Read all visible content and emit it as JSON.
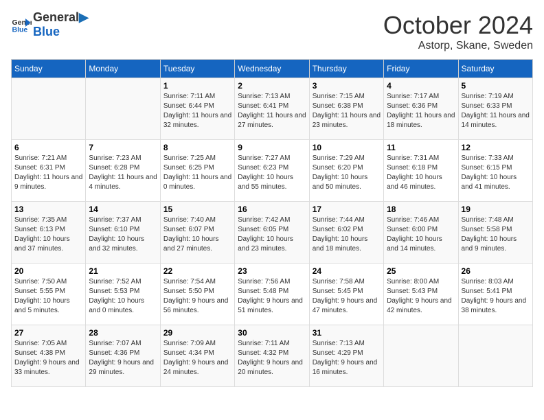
{
  "header": {
    "logo_line1": "General",
    "logo_line2": "Blue",
    "month": "October 2024",
    "location": "Astorp, Skane, Sweden"
  },
  "weekdays": [
    "Sunday",
    "Monday",
    "Tuesday",
    "Wednesday",
    "Thursday",
    "Friday",
    "Saturday"
  ],
  "weeks": [
    [
      {
        "day": "",
        "sunrise": "",
        "sunset": "",
        "daylight": ""
      },
      {
        "day": "",
        "sunrise": "",
        "sunset": "",
        "daylight": ""
      },
      {
        "day": "1",
        "sunrise": "Sunrise: 7:11 AM",
        "sunset": "Sunset: 6:44 PM",
        "daylight": "Daylight: 11 hours and 32 minutes."
      },
      {
        "day": "2",
        "sunrise": "Sunrise: 7:13 AM",
        "sunset": "Sunset: 6:41 PM",
        "daylight": "Daylight: 11 hours and 27 minutes."
      },
      {
        "day": "3",
        "sunrise": "Sunrise: 7:15 AM",
        "sunset": "Sunset: 6:38 PM",
        "daylight": "Daylight: 11 hours and 23 minutes."
      },
      {
        "day": "4",
        "sunrise": "Sunrise: 7:17 AM",
        "sunset": "Sunset: 6:36 PM",
        "daylight": "Daylight: 11 hours and 18 minutes."
      },
      {
        "day": "5",
        "sunrise": "Sunrise: 7:19 AM",
        "sunset": "Sunset: 6:33 PM",
        "daylight": "Daylight: 11 hours and 14 minutes."
      }
    ],
    [
      {
        "day": "6",
        "sunrise": "Sunrise: 7:21 AM",
        "sunset": "Sunset: 6:31 PM",
        "daylight": "Daylight: 11 hours and 9 minutes."
      },
      {
        "day": "7",
        "sunrise": "Sunrise: 7:23 AM",
        "sunset": "Sunset: 6:28 PM",
        "daylight": "Daylight: 11 hours and 4 minutes."
      },
      {
        "day": "8",
        "sunrise": "Sunrise: 7:25 AM",
        "sunset": "Sunset: 6:25 PM",
        "daylight": "Daylight: 11 hours and 0 minutes."
      },
      {
        "day": "9",
        "sunrise": "Sunrise: 7:27 AM",
        "sunset": "Sunset: 6:23 PM",
        "daylight": "Daylight: 10 hours and 55 minutes."
      },
      {
        "day": "10",
        "sunrise": "Sunrise: 7:29 AM",
        "sunset": "Sunset: 6:20 PM",
        "daylight": "Daylight: 10 hours and 50 minutes."
      },
      {
        "day": "11",
        "sunrise": "Sunrise: 7:31 AM",
        "sunset": "Sunset: 6:18 PM",
        "daylight": "Daylight: 10 hours and 46 minutes."
      },
      {
        "day": "12",
        "sunrise": "Sunrise: 7:33 AM",
        "sunset": "Sunset: 6:15 PM",
        "daylight": "Daylight: 10 hours and 41 minutes."
      }
    ],
    [
      {
        "day": "13",
        "sunrise": "Sunrise: 7:35 AM",
        "sunset": "Sunset: 6:13 PM",
        "daylight": "Daylight: 10 hours and 37 minutes."
      },
      {
        "day": "14",
        "sunrise": "Sunrise: 7:37 AM",
        "sunset": "Sunset: 6:10 PM",
        "daylight": "Daylight: 10 hours and 32 minutes."
      },
      {
        "day": "15",
        "sunrise": "Sunrise: 7:40 AM",
        "sunset": "Sunset: 6:07 PM",
        "daylight": "Daylight: 10 hours and 27 minutes."
      },
      {
        "day": "16",
        "sunrise": "Sunrise: 7:42 AM",
        "sunset": "Sunset: 6:05 PM",
        "daylight": "Daylight: 10 hours and 23 minutes."
      },
      {
        "day": "17",
        "sunrise": "Sunrise: 7:44 AM",
        "sunset": "Sunset: 6:02 PM",
        "daylight": "Daylight: 10 hours and 18 minutes."
      },
      {
        "day": "18",
        "sunrise": "Sunrise: 7:46 AM",
        "sunset": "Sunset: 6:00 PM",
        "daylight": "Daylight: 10 hours and 14 minutes."
      },
      {
        "day": "19",
        "sunrise": "Sunrise: 7:48 AM",
        "sunset": "Sunset: 5:58 PM",
        "daylight": "Daylight: 10 hours and 9 minutes."
      }
    ],
    [
      {
        "day": "20",
        "sunrise": "Sunrise: 7:50 AM",
        "sunset": "Sunset: 5:55 PM",
        "daylight": "Daylight: 10 hours and 5 minutes."
      },
      {
        "day": "21",
        "sunrise": "Sunrise: 7:52 AM",
        "sunset": "Sunset: 5:53 PM",
        "daylight": "Daylight: 10 hours and 0 minutes."
      },
      {
        "day": "22",
        "sunrise": "Sunrise: 7:54 AM",
        "sunset": "Sunset: 5:50 PM",
        "daylight": "Daylight: 9 hours and 56 minutes."
      },
      {
        "day": "23",
        "sunrise": "Sunrise: 7:56 AM",
        "sunset": "Sunset: 5:48 PM",
        "daylight": "Daylight: 9 hours and 51 minutes."
      },
      {
        "day": "24",
        "sunrise": "Sunrise: 7:58 AM",
        "sunset": "Sunset: 5:45 PM",
        "daylight": "Daylight: 9 hours and 47 minutes."
      },
      {
        "day": "25",
        "sunrise": "Sunrise: 8:00 AM",
        "sunset": "Sunset: 5:43 PM",
        "daylight": "Daylight: 9 hours and 42 minutes."
      },
      {
        "day": "26",
        "sunrise": "Sunrise: 8:03 AM",
        "sunset": "Sunset: 5:41 PM",
        "daylight": "Daylight: 9 hours and 38 minutes."
      }
    ],
    [
      {
        "day": "27",
        "sunrise": "Sunrise: 7:05 AM",
        "sunset": "Sunset: 4:38 PM",
        "daylight": "Daylight: 9 hours and 33 minutes."
      },
      {
        "day": "28",
        "sunrise": "Sunrise: 7:07 AM",
        "sunset": "Sunset: 4:36 PM",
        "daylight": "Daylight: 9 hours and 29 minutes."
      },
      {
        "day": "29",
        "sunrise": "Sunrise: 7:09 AM",
        "sunset": "Sunset: 4:34 PM",
        "daylight": "Daylight: 9 hours and 24 minutes."
      },
      {
        "day": "30",
        "sunrise": "Sunrise: 7:11 AM",
        "sunset": "Sunset: 4:32 PM",
        "daylight": "Daylight: 9 hours and 20 minutes."
      },
      {
        "day": "31",
        "sunrise": "Sunrise: 7:13 AM",
        "sunset": "Sunset: 4:29 PM",
        "daylight": "Daylight: 9 hours and 16 minutes."
      },
      {
        "day": "",
        "sunrise": "",
        "sunset": "",
        "daylight": ""
      },
      {
        "day": "",
        "sunrise": "",
        "sunset": "",
        "daylight": ""
      }
    ]
  ]
}
